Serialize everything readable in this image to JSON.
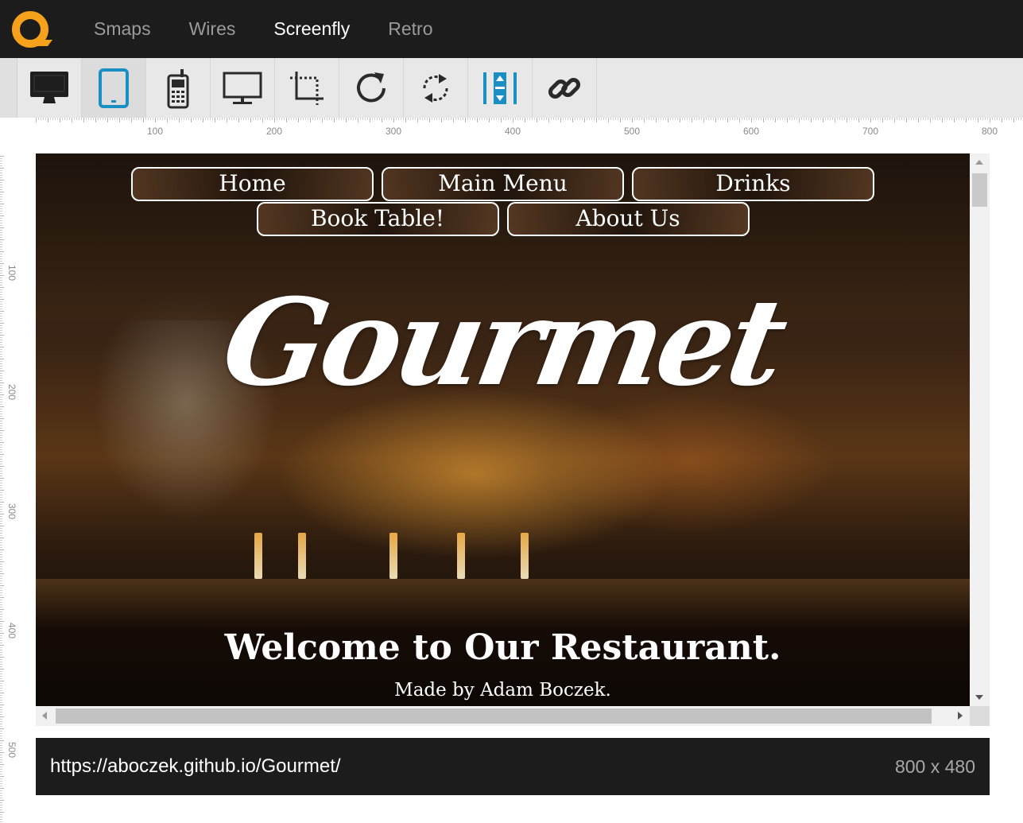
{
  "app": {
    "logo_icon": "app-logo-icon",
    "brand_color": "#f5a11b",
    "tabs": [
      {
        "label": "Smaps"
      },
      {
        "label": "Wires"
      },
      {
        "label": "Screenfly"
      },
      {
        "label": "Retro"
      }
    ],
    "active_tab": "Screenfly"
  },
  "toolbar": {
    "accent_color": "#1a8fc4",
    "tools": [
      {
        "icon": "desktop-icon",
        "active": false
      },
      {
        "icon": "tablet-icon",
        "active": true
      },
      {
        "icon": "mobile-phone-icon",
        "active": false
      },
      {
        "icon": "television-icon",
        "active": false
      },
      {
        "icon": "custom-size-icon",
        "active": false
      },
      {
        "icon": "refresh-icon",
        "active": false
      },
      {
        "icon": "rotate-icon",
        "active": false
      },
      {
        "icon": "scroll-toggle-icon",
        "active": false
      },
      {
        "icon": "share-link-icon",
        "active": false
      }
    ]
  },
  "rulers": {
    "horizontal": [
      "100",
      "200",
      "300",
      "400",
      "500",
      "600",
      "700",
      "800"
    ],
    "vertical": [
      "100",
      "200",
      "300",
      "400",
      "500"
    ]
  },
  "site": {
    "nav": [
      "Home",
      "Main Menu",
      "Drinks",
      "Book Table!",
      "About Us"
    ],
    "brand": "Gourmet",
    "headline": "Welcome to Our Restaurant.",
    "byline": "Made by Adam Boczek."
  },
  "status": {
    "url": "https://aboczek.github.io/Gourmet/",
    "size": "800 x 480"
  }
}
